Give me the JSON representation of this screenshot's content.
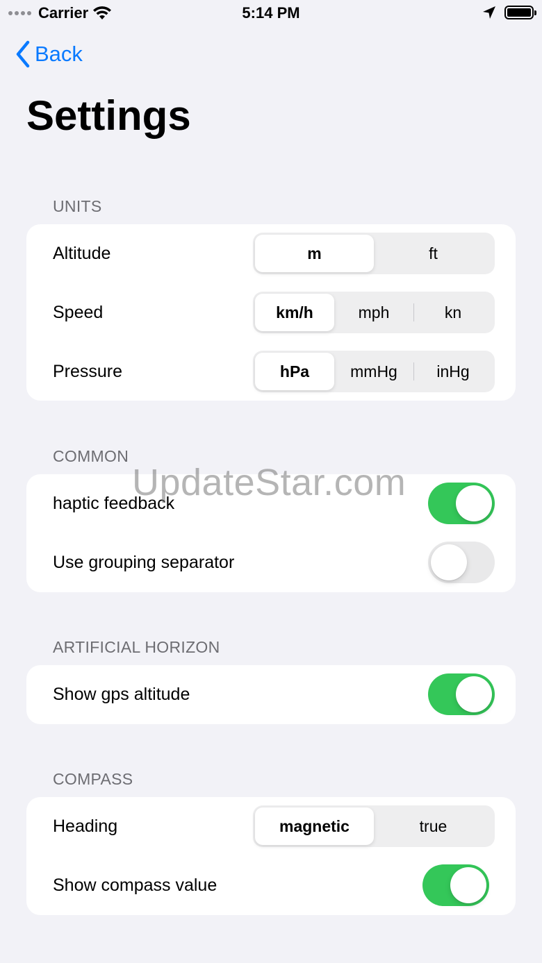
{
  "status_bar": {
    "carrier": "Carrier",
    "time": "5:14 PM"
  },
  "nav": {
    "back_label": "Back",
    "title": "Settings"
  },
  "sections": {
    "units": {
      "header": "UNITS",
      "altitude": {
        "label": "Altitude",
        "options": [
          "m",
          "ft"
        ],
        "selected": "m"
      },
      "speed": {
        "label": "Speed",
        "options": [
          "km/h",
          "mph",
          "kn"
        ],
        "selected": "km/h"
      },
      "pressure": {
        "label": "Pressure",
        "options": [
          "hPa",
          "mmHg",
          "inHg"
        ],
        "selected": "hPa"
      }
    },
    "common": {
      "header": "COMMON",
      "haptic": {
        "label": "haptic feedback",
        "on": true
      },
      "grouping": {
        "label": "Use grouping separator",
        "on": false
      }
    },
    "horizon": {
      "header": "ARTIFICIAL HORIZON",
      "gps_altitude": {
        "label": "Show gps altitude",
        "on": true
      }
    },
    "compass": {
      "header": "COMPASS",
      "heading": {
        "label": "Heading",
        "options": [
          "magnetic",
          "true"
        ],
        "selected": "magnetic"
      },
      "compass_value": {
        "label": "Show compass value",
        "on": true
      }
    }
  },
  "watermark": "UpdateStar.com",
  "colors": {
    "accent": "#0a7aff",
    "toggle_on": "#34c759",
    "toggle_off": "#e9e9ea",
    "background": "#f2f2f7"
  },
  "icons": [
    "signal-icon",
    "wifi-icon",
    "location-arrow-icon",
    "battery-icon",
    "chevron-left-icon"
  ]
}
